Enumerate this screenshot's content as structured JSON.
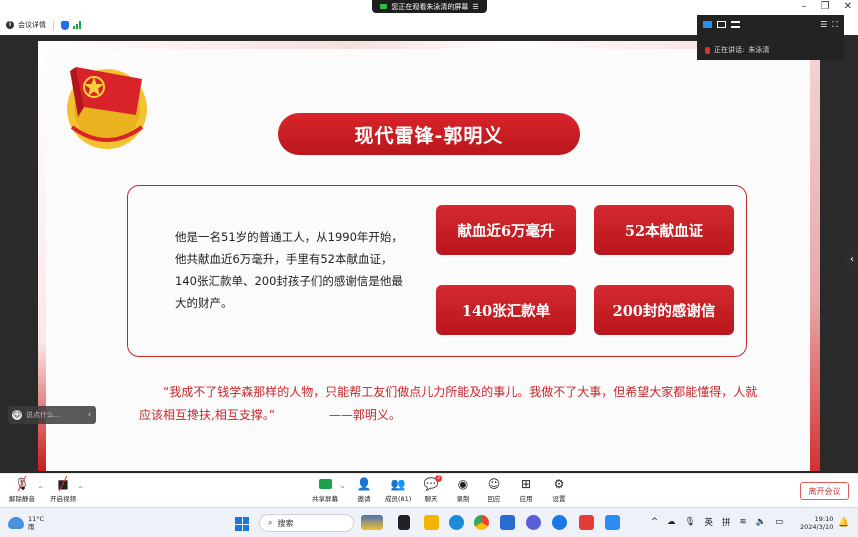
{
  "banner": {
    "text": "您正在观看朱泳清的屏幕"
  },
  "titlebar": {
    "meeting_info_label": "会议详情"
  },
  "speaker": {
    "label": "正在讲话:",
    "name": "朱泳清"
  },
  "slide": {
    "title": "现代雷锋-郭明义",
    "description": "他是一名51岁的普通工人，从1990年开始，他共献血近6万毫升，手里有52本献血证，140张汇款单、200封孩子们的感谢信是他最大的财产。",
    "tags": [
      "献血近6万毫升",
      "52本献血证",
      "140张汇款单",
      "200封的感谢信"
    ],
    "quote": "“我成不了钱学森那样的人物，只能帮工友们做点儿力所能及的事儿。我做不了大事，但希望大家都能懂得，人就应该相互搀扶,相互支撑。”",
    "quote_author": "——郭明义。",
    "emblem_text": "中国共青团"
  },
  "chat": {
    "placeholder": "说点什么..."
  },
  "toolbar": {
    "unmute": "解除静音",
    "start_video": "开启视频",
    "share_screen": "共享屏幕",
    "invite": "邀请",
    "members": "成员(81)",
    "chat": "聊天",
    "record": "录制",
    "reactions": "回应",
    "apps": "应用",
    "settings": "设置",
    "leave": "离开会议"
  },
  "taskbar": {
    "weather_temp": "11°C",
    "weather_desc": "雨",
    "search": "搜索",
    "ime_lang": "英",
    "ime_mode": "拼",
    "time": "19:10",
    "date": "2024/3/10"
  },
  "colors": {
    "accent_red": "#c8252a",
    "stage_dark": "#2a2a2a",
    "leave_red": "#d33333"
  }
}
